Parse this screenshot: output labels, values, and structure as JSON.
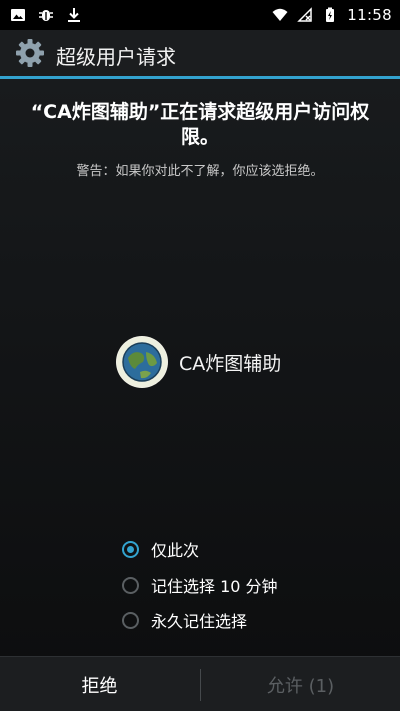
{
  "status_bar": {
    "time": "11:58",
    "left_icons": [
      "image-icon",
      "bug-icon",
      "download-icon"
    ],
    "right_icons": [
      "wifi-icon",
      "no-sim-icon",
      "battery-icon"
    ]
  },
  "header": {
    "title": "超级用户请求",
    "icon": "gear-icon"
  },
  "message": {
    "main": "“CA炸图辅助”正在请求超级用户访问权限。",
    "warning": "警告：如果你对此不了解，你应该选拒绝。"
  },
  "app": {
    "name": "CA炸图辅助",
    "icon": "earth-icon"
  },
  "options": [
    {
      "label": "仅此次",
      "checked": true
    },
    {
      "label": "记住选择 10 分钟",
      "checked": false
    },
    {
      "label": "永久记住选择",
      "checked": false
    }
  ],
  "buttons": {
    "deny_label": "拒绝",
    "allow_label": "允许 (1)"
  },
  "colors": {
    "accent": "#33a3cf",
    "disabled_text": "#5b5f62"
  }
}
